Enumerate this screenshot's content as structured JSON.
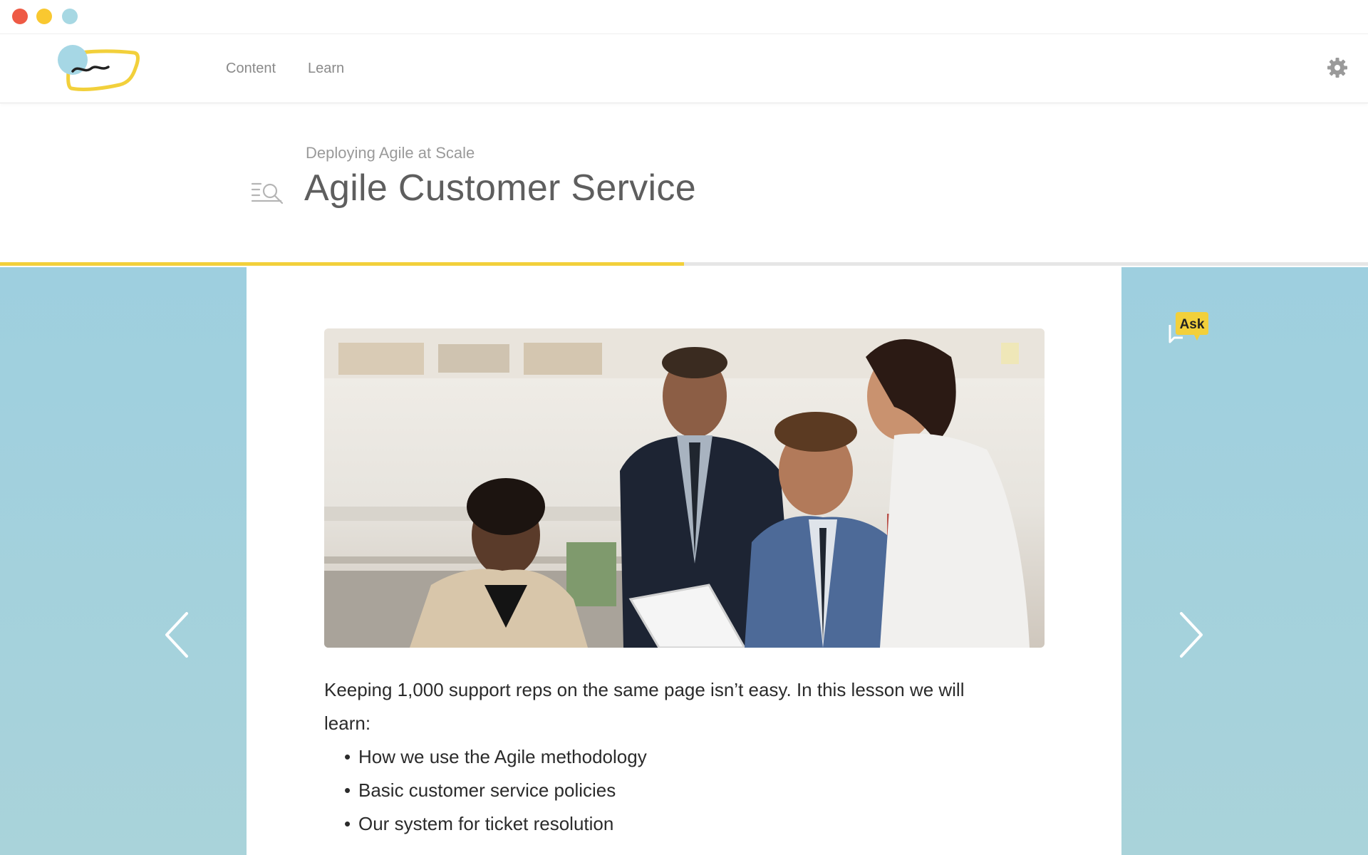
{
  "window": {
    "controls": [
      "close",
      "minimize",
      "zoom"
    ]
  },
  "colors": {
    "close": "#ee5a45",
    "minimize": "#f9c830",
    "zoom": "#a7d8e3",
    "accent_yellow": "#f2d03b",
    "side_blue": "#9ecfdf",
    "logo_circle": "#a6d7e5",
    "logo_outline": "#f2d03b"
  },
  "nav": {
    "items": [
      {
        "label": "Content"
      },
      {
        "label": "Learn"
      }
    ]
  },
  "header": {
    "settings_icon": "gear-icon",
    "logo_icon": "app-logo"
  },
  "lesson": {
    "course": "Deploying Agile at Scale",
    "title": "Agile Customer Service",
    "toc_icon": "table-of-contents-icon",
    "progress": 0.5,
    "intro": "Keeping 1,000 support reps on the same page isn’t easy. In this lesson we will learn:",
    "bullets": [
      "How we use the Agile methodology",
      "Basic customer service policies",
      "Our system for ticket resolution"
    ]
  },
  "navigation": {
    "prev_icon": "chevron-left-icon",
    "next_icon": "chevron-right-icon"
  },
  "ask": {
    "label": "Ask"
  }
}
